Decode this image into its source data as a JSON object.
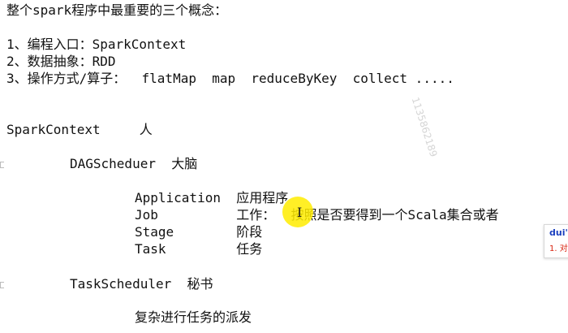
{
  "notes": {
    "heading": "整个spark程序中最重要的三个概念：",
    "concept_1": "1、编程入口：SparkContext",
    "concept_2": "2、数据抽象：RDD",
    "concept_3": "3、操作方式/算子：  flatMap  map  reduceByKey  collect .....",
    "spark_context": "SparkContext     人",
    "dag_scheduler": "DAGScheduer  大脑",
    "application": "Application  应用程序",
    "job_term": "Job          工作：  按照是否要得到一个Scala集合或者",
    "stage": "Stage        阶段",
    "task": "Task         任务",
    "task_scheduler": "TaskScheduler  秘书",
    "dispatch": "复杂进行任务的派发"
  },
  "watermark": "1135862189",
  "popup": {
    "title": "dui'x",
    "item": "1. 对"
  },
  "colors": {
    "cursor_highlight": "#ffec00",
    "popup_title": "#1a3fbf",
    "popup_item": "#d9230f"
  }
}
